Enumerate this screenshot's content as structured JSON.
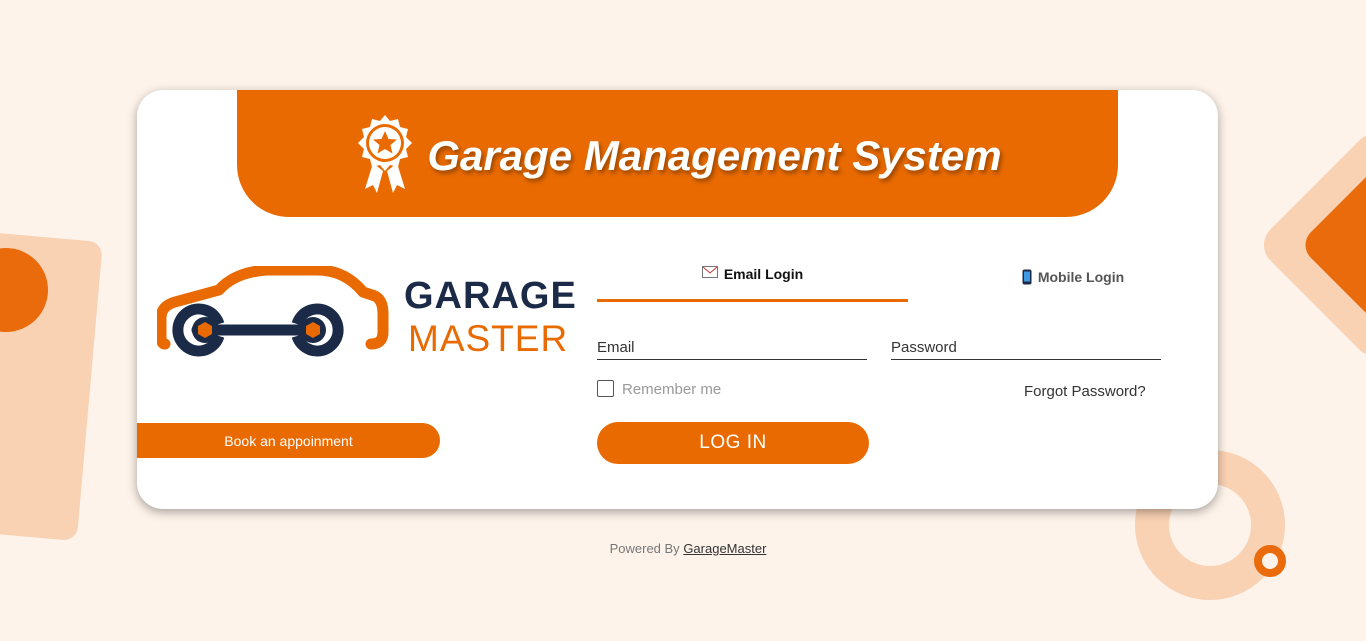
{
  "header": {
    "title": "Garage Management System",
    "badge_icon": "award-ribbon-icon"
  },
  "logo": {
    "word_1": "GARAGE",
    "word_2": "MASTER",
    "icon": "car-wrench-icon"
  },
  "book_button_label": "Book an appoinment",
  "tabs": [
    {
      "label": "Email Login",
      "icon": "envelope-icon",
      "active": true
    },
    {
      "label": "Mobile Login",
      "icon": "mobile-phone-icon",
      "active": false
    }
  ],
  "form": {
    "email_placeholder": "Email",
    "password_placeholder": "Password",
    "remember_label": "Remember me",
    "remember_checked": false,
    "forgot_label": "Forgot Password?",
    "login_label": "LOG IN"
  },
  "footer": {
    "prefix": "Powered By",
    "link": "GarageMaster"
  },
  "colors": {
    "accent": "#e96a00",
    "navy": "#1b2a47",
    "background": "#fdf3ea",
    "peach": "#f9d1b3"
  }
}
